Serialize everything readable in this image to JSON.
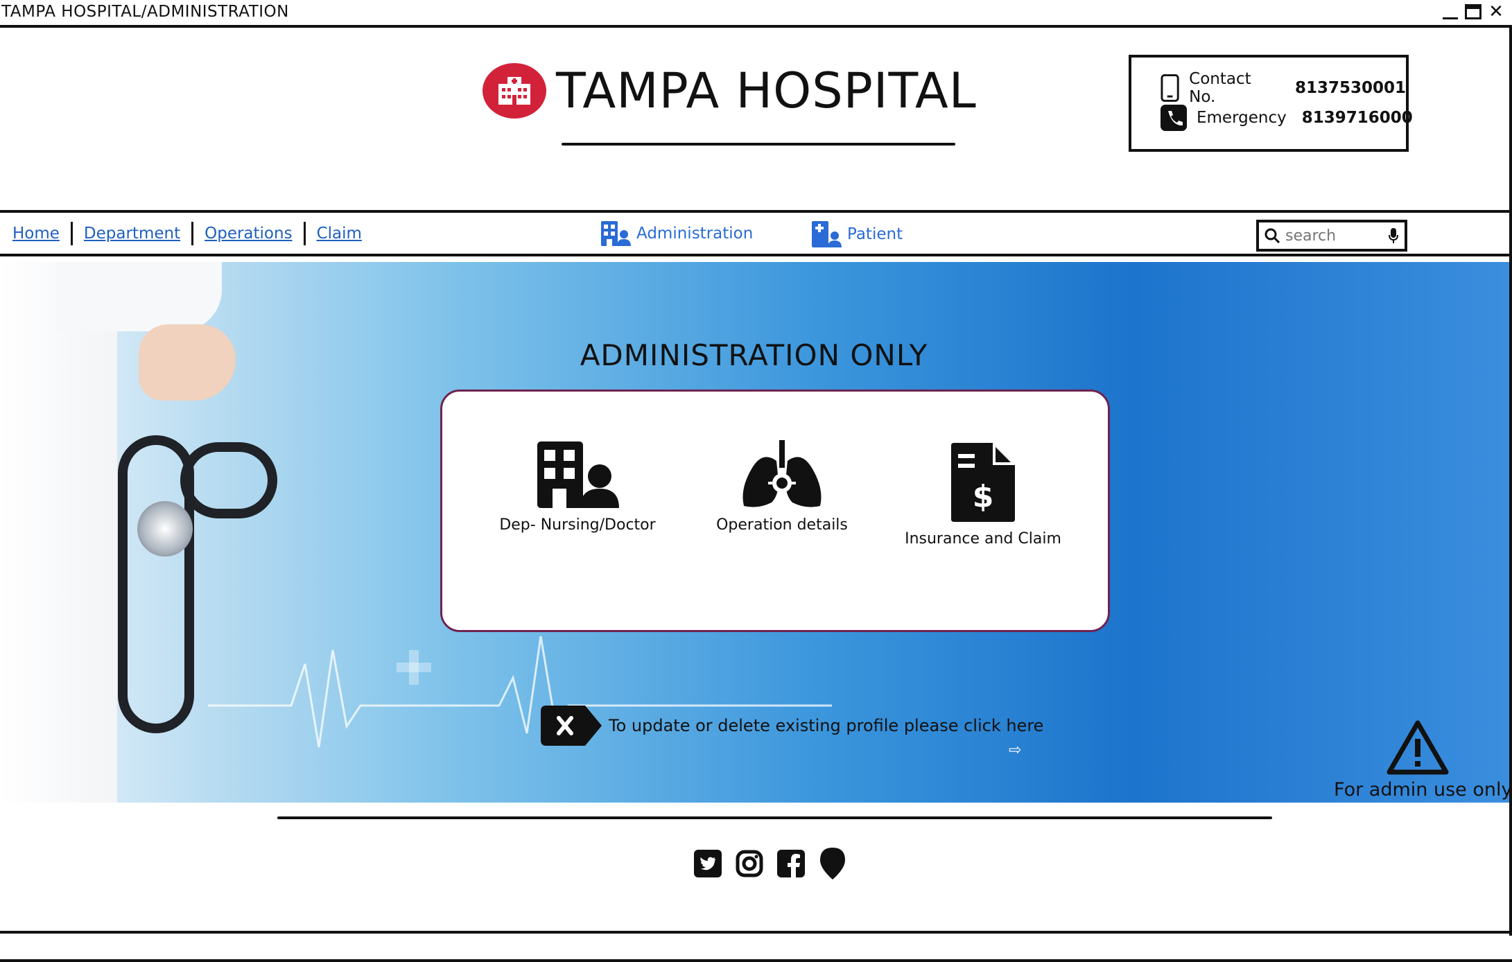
{
  "window": {
    "title": "TAMPA HOSPITAL/ADMINISTRATION"
  },
  "header": {
    "brand": "TAMPA HOSPITAL",
    "contact_label": "Contact No.",
    "contact_value": "8137530001",
    "emergency_label": "Emergency",
    "emergency_value": "8139716000"
  },
  "nav": {
    "links": [
      "Home",
      "Department",
      "Operations",
      "Claim"
    ],
    "admin_tab": "Administration",
    "patient_tab": "Patient",
    "search_placeholder": "search"
  },
  "hero": {
    "title": "ADMINISTRATION ONLY",
    "cards": [
      {
        "label": "Dep- Nursing/Doctor",
        "icon": "building-user-icon"
      },
      {
        "label": "Operation details",
        "icon": "lungs-virus-icon"
      },
      {
        "label": "Insurance and Claim",
        "icon": "file-invoice-dollar-icon"
      }
    ],
    "update_text": "To update or delete existing profile please click here",
    "warning_text": "For admin use only"
  },
  "footer": {
    "socials": [
      "twitter-icon",
      "instagram-icon",
      "facebook-icon",
      "location-pin-icon"
    ]
  },
  "colors": {
    "accent": "#2a6bd6",
    "logo_red": "#d2223a",
    "card_border": "#6f2350"
  }
}
